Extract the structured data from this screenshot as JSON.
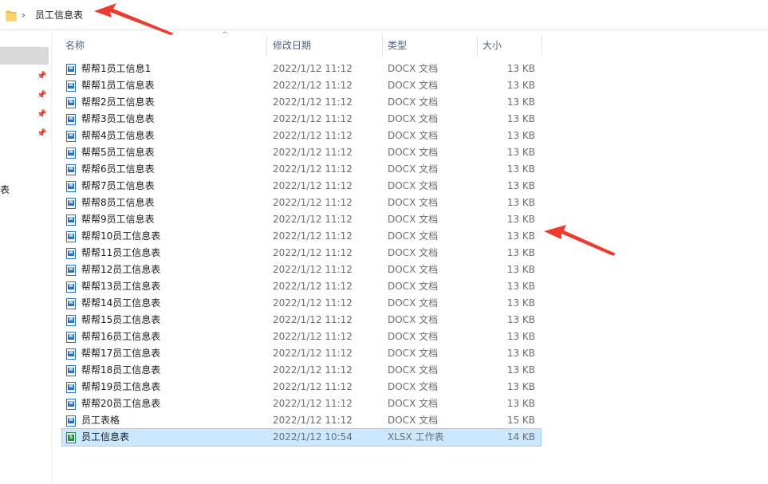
{
  "address_bar": {
    "folder_icon": "folder-icon",
    "chevron": "›",
    "crumb": "员工信息表"
  },
  "nav": {
    "pins": [
      "pin-icon",
      "pin-icon",
      "pin-icon",
      "pin-icon"
    ],
    "cut_label": "表"
  },
  "columns": {
    "name": "名称",
    "date": "修改日期",
    "type": "类型",
    "size": "大小"
  },
  "files": [
    {
      "name": "帮帮1员工信息1",
      "date": "2022/1/12 11:12",
      "type": "DOCX 文档",
      "size": "13 KB",
      "icon": "word"
    },
    {
      "name": "帮帮1员工信息表",
      "date": "2022/1/12 11:12",
      "type": "DOCX 文档",
      "size": "13 KB",
      "icon": "word"
    },
    {
      "name": "帮帮2员工信息表",
      "date": "2022/1/12 11:12",
      "type": "DOCX 文档",
      "size": "13 KB",
      "icon": "word"
    },
    {
      "name": "帮帮3员工信息表",
      "date": "2022/1/12 11:12",
      "type": "DOCX 文档",
      "size": "13 KB",
      "icon": "word"
    },
    {
      "name": "帮帮4员工信息表",
      "date": "2022/1/12 11:12",
      "type": "DOCX 文档",
      "size": "13 KB",
      "icon": "word"
    },
    {
      "name": "帮帮5员工信息表",
      "date": "2022/1/12 11:12",
      "type": "DOCX 文档",
      "size": "13 KB",
      "icon": "word"
    },
    {
      "name": "帮帮6员工信息表",
      "date": "2022/1/12 11:12",
      "type": "DOCX 文档",
      "size": "13 KB",
      "icon": "word"
    },
    {
      "name": "帮帮7员工信息表",
      "date": "2022/1/12 11:12",
      "type": "DOCX 文档",
      "size": "13 KB",
      "icon": "word"
    },
    {
      "name": "帮帮8员工信息表",
      "date": "2022/1/12 11:12",
      "type": "DOCX 文档",
      "size": "13 KB",
      "icon": "word"
    },
    {
      "name": "帮帮9员工信息表",
      "date": "2022/1/12 11:12",
      "type": "DOCX 文档",
      "size": "13 KB",
      "icon": "word"
    },
    {
      "name": "帮帮10员工信息表",
      "date": "2022/1/12 11:12",
      "type": "DOCX 文档",
      "size": "13 KB",
      "icon": "word"
    },
    {
      "name": "帮帮11员工信息表",
      "date": "2022/1/12 11:12",
      "type": "DOCX 文档",
      "size": "13 KB",
      "icon": "word"
    },
    {
      "name": "帮帮12员工信息表",
      "date": "2022/1/12 11:12",
      "type": "DOCX 文档",
      "size": "13 KB",
      "icon": "word"
    },
    {
      "name": "帮帮13员工信息表",
      "date": "2022/1/12 11:12",
      "type": "DOCX 文档",
      "size": "13 KB",
      "icon": "word"
    },
    {
      "name": "帮帮14员工信息表",
      "date": "2022/1/12 11:12",
      "type": "DOCX 文档",
      "size": "13 KB",
      "icon": "word"
    },
    {
      "name": "帮帮15员工信息表",
      "date": "2022/1/12 11:12",
      "type": "DOCX 文档",
      "size": "13 KB",
      "icon": "word"
    },
    {
      "name": "帮帮16员工信息表",
      "date": "2022/1/12 11:12",
      "type": "DOCX 文档",
      "size": "13 KB",
      "icon": "word"
    },
    {
      "name": "帮帮17员工信息表",
      "date": "2022/1/12 11:12",
      "type": "DOCX 文档",
      "size": "13 KB",
      "icon": "word"
    },
    {
      "name": "帮帮18员工信息表",
      "date": "2022/1/12 11:12",
      "type": "DOCX 文档",
      "size": "13 KB",
      "icon": "word"
    },
    {
      "name": "帮帮19员工信息表",
      "date": "2022/1/12 11:12",
      "type": "DOCX 文档",
      "size": "13 KB",
      "icon": "word"
    },
    {
      "name": "帮帮20员工信息表",
      "date": "2022/1/12 11:12",
      "type": "DOCX 文档",
      "size": "13 KB",
      "icon": "word"
    },
    {
      "name": "员工表格",
      "date": "2022/1/12 11:12",
      "type": "DOCX 文档",
      "size": "15 KB",
      "icon": "word"
    },
    {
      "name": "员工信息表",
      "date": "2022/1/12 10:54",
      "type": "XLSX 工作表",
      "size": "14 KB",
      "icon": "excel",
      "selected": true
    }
  ],
  "colors": {
    "annotation_arrow": "#ee3a2f",
    "selection_bg": "#cce8ff",
    "word_blue": "#2b6fc6",
    "excel_green": "#1f8a4c"
  }
}
